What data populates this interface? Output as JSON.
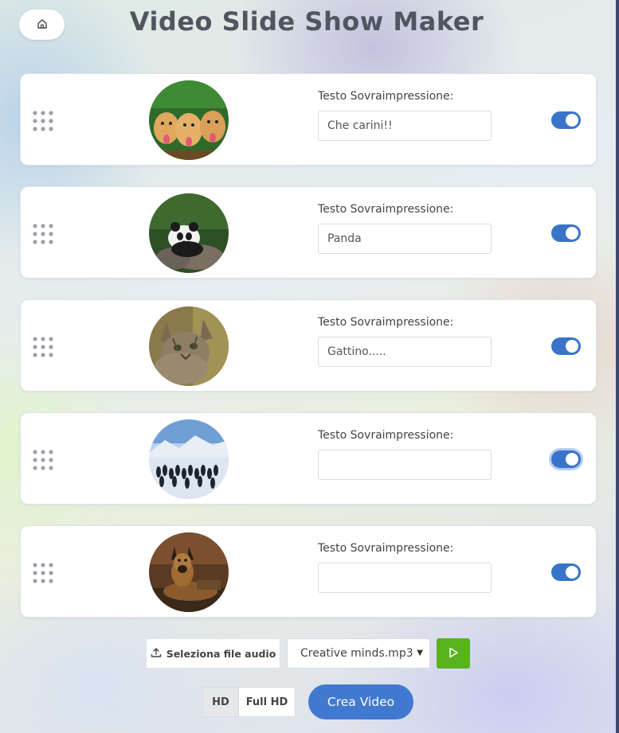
{
  "app": {
    "title": "Video Slide Show Maker"
  },
  "slides": [
    {
      "image": "golden-retriever-puppies",
      "label": "Testo Sovraimpressione:",
      "value": "Che carini!!",
      "toggle_on": true
    },
    {
      "image": "panda",
      "label": "Testo Sovraimpressione:",
      "value": "Panda",
      "toggle_on": true
    },
    {
      "image": "cat",
      "label": "Testo Sovraimpressione:",
      "value": "Gattino.....",
      "toggle_on": true
    },
    {
      "image": "penguins",
      "label": "Testo Sovraimpressione:",
      "value": "",
      "toggle_on": true
    },
    {
      "image": "german-shepherd",
      "label": "Testo Sovraimpressione:",
      "value": "",
      "toggle_on": true
    }
  ],
  "audio": {
    "select_file_label": "Seleziona file audio",
    "selected_file": "Creative minds.mp3"
  },
  "resolution": {
    "hd_label": "HD",
    "full_hd_label": "Full HD",
    "selected": "HD"
  },
  "create_label": "Crea Video",
  "colors": {
    "accent": "#3a74c8",
    "play": "#57b31e",
    "create": "#4279d0"
  }
}
